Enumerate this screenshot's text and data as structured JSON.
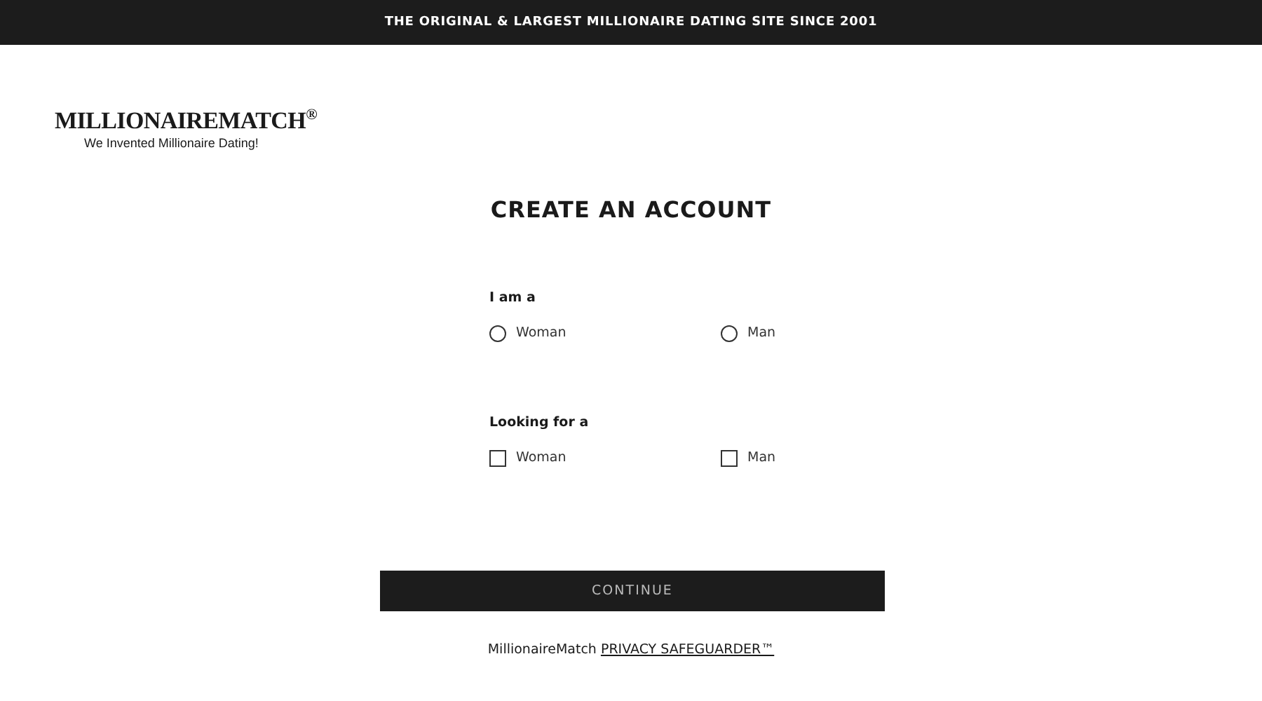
{
  "banner": "THE ORIGINAL & LARGEST MILLIONAIRE DATING SITE SINCE 2001",
  "logo": {
    "name": "MILLIONAIREMATCH$^{®}$",
    "tagline": "We Invented Millionaire Dating!"
  },
  "title": "CREATE AN ACCOUNT",
  "groups": [
    {
      "label": "I am a",
      "options": [
        {
          "kind": "radio",
          "label": "Woman",
          "checked": false
        },
        {
          "kind": "radio",
          "label": "Man",
          "checked": false
        }
      ]
    },
    {
      "label": "Looking for a",
      "options": [
        {
          "kind": "checkbox",
          "label": "Woman",
          "checked": false
        },
        {
          "kind": "checkbox",
          "label": "Man",
          "checked": false
        }
      ]
    }
  ],
  "button": "CONTINUE",
  "footer": {
    "text": "MillionaireMatch",
    "link": "PRIVACY SAFEGUARDER™"
  }
}
